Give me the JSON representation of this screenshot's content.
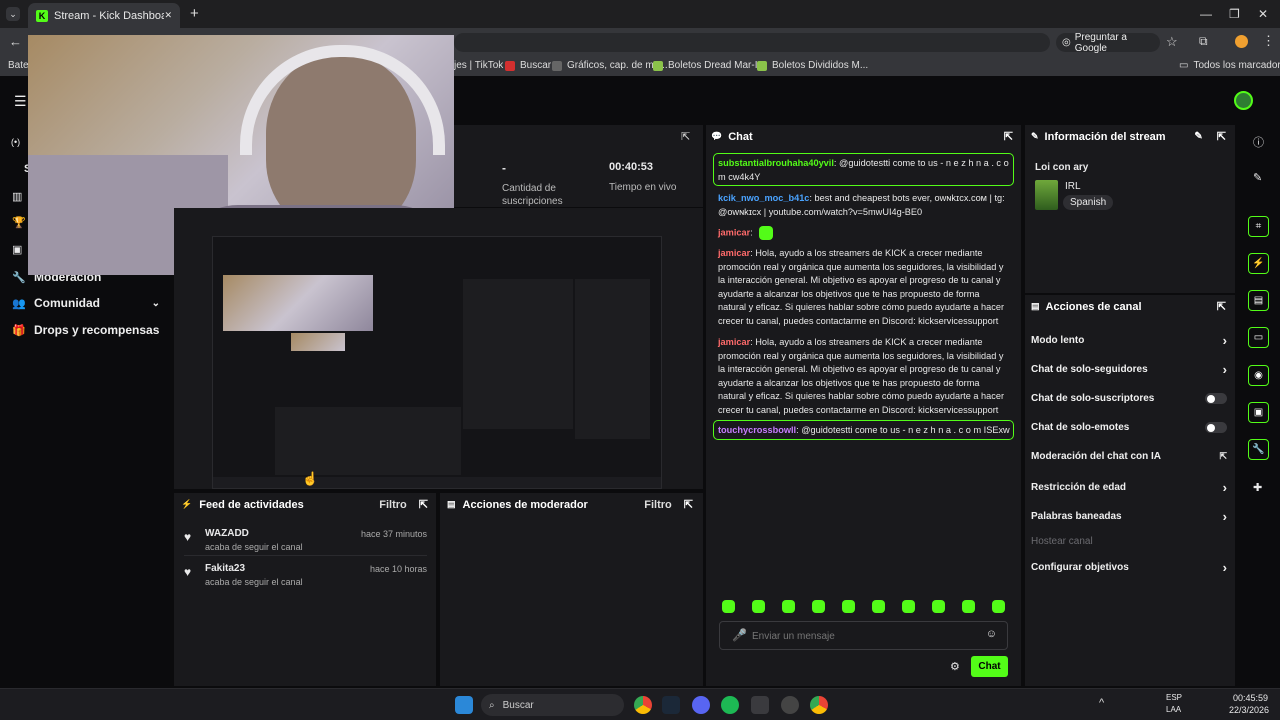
{
  "browser": {
    "tab_title": "Stream - Kick Dashboard",
    "tab_close": "✕",
    "new_tab": "+",
    "ask_google": "Preguntar a Google",
    "bookmarks": [
      {
        "label": "Bater"
      },
      {
        "label": "jes | TikTok"
      },
      {
        "label": "Buscar"
      },
      {
        "label": "Gráficos, cap. de me..."
      },
      {
        "label": "Boletos Dread Mar-I..."
      },
      {
        "label": "Boletos Divididos M..."
      }
    ],
    "all_bookmarks": "Todos los marcadores"
  },
  "sidebar": {
    "items": [
      {
        "label": "Moderación"
      },
      {
        "label": "Comunidad"
      },
      {
        "label": "Drops y recompensas"
      }
    ],
    "letter_s": "S"
  },
  "stats": {
    "subs_value": "-",
    "subs_label": "Cantidad de suscripciones",
    "time_value": "00:40:53",
    "time_label": "Tiempo en vivo"
  },
  "activity_feed": {
    "title": "Feed de actividades",
    "filter": "Filtro",
    "items": [
      {
        "name": "WAZADD",
        "action": "acaba de seguir el canal",
        "time": "hace 37 minutos"
      },
      {
        "name": "Fakita23",
        "action": "acaba de seguir el canal",
        "time": "hace 10 horas"
      }
    ]
  },
  "mod_actions": {
    "title": "Acciones de moderador",
    "filter": "Filtro"
  },
  "chat": {
    "title": "Chat",
    "messages": [
      {
        "user": "substantialbrouhaha40yvil",
        "text": ": @guidotestti come to us - n e z h n a . c o m cw4k4Y"
      },
      {
        "user": "kcik_nwo_moc_b41c",
        "text": ": best and cheapest bots ever, ᴏwɴkɪcx.cᴏᴍ | tg: @ᴏwɴkɪcx | youtube.com/watch?v=5mwUI4g-BE0"
      },
      {
        "user": "jamicar",
        "text": ":"
      },
      {
        "user": "jamicar",
        "text": ": Hola, ayudo a los streamers de KICK a crecer mediante promoción real y orgánica que aumenta los seguidores, la visibilidad y la interacción general. Mi objetivo es apoyar el progreso de tu canal y ayudarte a alcanzar los objetivos que te has propuesto de forma natural y eficaz. Si quieres hablar sobre cómo puedo ayudarte a hacer crecer tu canal, puedes contactarme en Discord: kickservicessupport"
      },
      {
        "user": "jamicar",
        "text": ": Hola, ayudo a los streamers de KICK a crecer mediante promoción real y orgánica que aumenta los seguidores, la visibilidad y la interacción general. Mi objetivo es apoyar el progreso de tu canal y ayudarte a alcanzar los objetivos que te has propuesto de forma natural y eficaz. Si quieres hablar sobre cómo puedo ayudarte a hacer crecer tu canal, puedes contactarme en Discord: kickservicessupport"
      },
      {
        "user": "touchycrossbowll",
        "text": ": @guidotestti come to us - n e z h n a . c o m ISExw"
      }
    ],
    "input_placeholder": "Enviar un mensaje",
    "send_label": "Chat"
  },
  "stream_info": {
    "title": "Información del stream",
    "stream_title": "Loi con ary",
    "category": "IRL",
    "language": "Spanish"
  },
  "channel_actions": {
    "title": "Acciones de canal",
    "items": [
      {
        "label": "Modo lento",
        "control": "chevron"
      },
      {
        "label": "Chat de solo-seguidores",
        "control": "chevron"
      },
      {
        "label": "Chat de solo-suscriptores",
        "control": "toggle"
      },
      {
        "label": "Chat de solo-emotes",
        "control": "toggle"
      },
      {
        "label": "Moderación del chat con IA",
        "control": "external"
      },
      {
        "label": "Restricción de edad",
        "control": "chevron"
      },
      {
        "label": "Palabras baneadas",
        "control": "chevron"
      },
      {
        "label": "Hostear canal",
        "control": "none"
      },
      {
        "label": "Configurar objetivos",
        "control": "chevron"
      }
    ]
  },
  "taskbar": {
    "search": "Buscar",
    "lang": "ESP",
    "lang2": "LAA",
    "time": "00:45:59",
    "date": "22/3/2026"
  },
  "colors": {
    "accent": "#53fc18",
    "panel": "#19191c",
    "bg": "#0b0b0d"
  }
}
